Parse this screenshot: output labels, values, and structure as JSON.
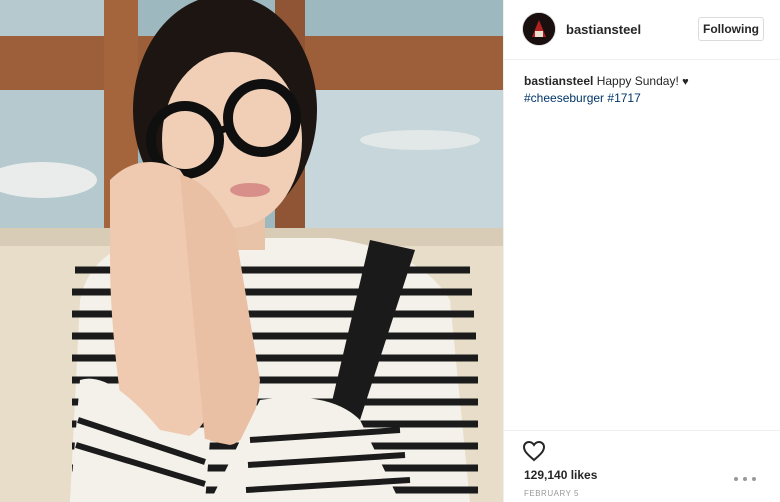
{
  "post": {
    "username": "bastiansteel",
    "follow_label": "Following",
    "caption": {
      "user": "bastiansteel",
      "text": "Happy Sunday!",
      "emoji": "♥",
      "hashtags": [
        "#cheeseburger",
        "#1717"
      ]
    },
    "likes": "129,140 likes",
    "date": "FEBRUARY 5"
  },
  "icons": {
    "like": "heart-outline-icon",
    "more": "more-options-icon"
  },
  "colors": {
    "hashtag": "#003569",
    "border": "#efefef"
  }
}
